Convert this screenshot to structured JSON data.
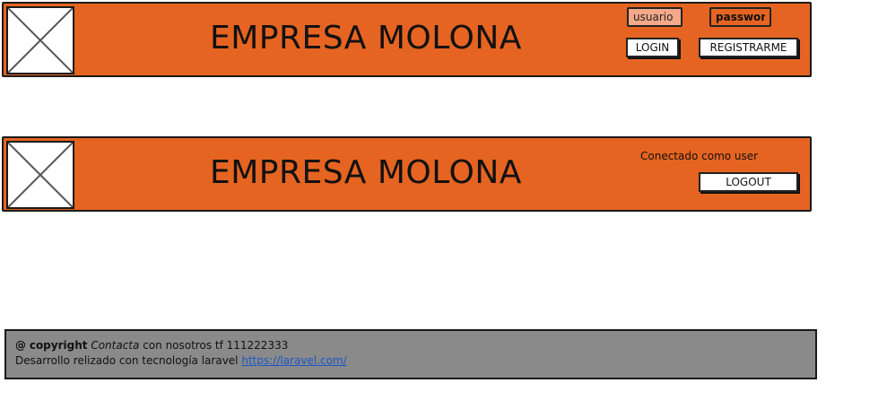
{
  "header_logged_out": {
    "logo_icon": "image-placeholder-icon",
    "title": "EMPRESA MOLONA",
    "username_placeholder": "usuario",
    "password_placeholder": "password",
    "login_label": "LOGIN",
    "register_label": "REGISTRARME"
  },
  "header_logged_in": {
    "logo_icon": "image-placeholder-icon",
    "title": "EMPRESA MOLONA",
    "status_text": "Conectado como user",
    "logout_label": "LOGOUT"
  },
  "footer": {
    "at_symbol": "@",
    "copyright": "copyright",
    "contact_word": "Contacta",
    "contact_rest": "con nosotros tf 111222333",
    "dev_text": "Desarrollo  relizado con tecnología laravel",
    "link_text": "https://laravel.com/"
  },
  "colors": {
    "header_bg": "#e66421",
    "footer_bg": "#8a8a8a",
    "username_field_bg": "#f4a98a",
    "link": "#1a56c4"
  }
}
